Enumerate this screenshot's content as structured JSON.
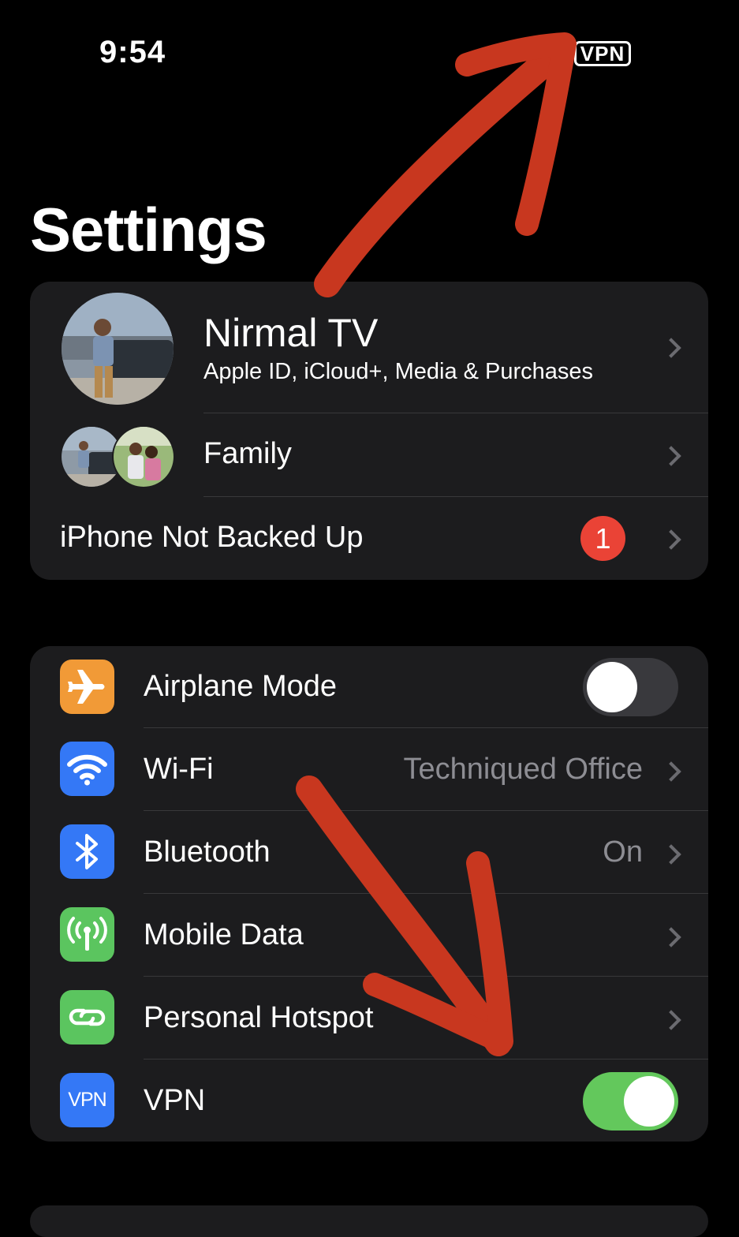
{
  "status_bar": {
    "time": "9:54",
    "vpn_indicator": "VPN"
  },
  "page": {
    "title": "Settings"
  },
  "account": {
    "name": "Nirmal TV",
    "subtitle": "Apple ID, iCloud+, Media & Purchases",
    "family_label": "Family",
    "backup_label": "iPhone Not Backed Up",
    "backup_badge": "1"
  },
  "connectivity": {
    "airplane": {
      "label": "Airplane Mode",
      "icon": "airplane-icon",
      "icon_color": "#f19a37",
      "on": false
    },
    "wifi": {
      "label": "Wi-Fi",
      "value": "Techniqued Office",
      "icon": "wifi-icon",
      "icon_color": "#3478f6"
    },
    "bluetooth": {
      "label": "Bluetooth",
      "value": "On",
      "icon": "bluetooth-icon",
      "icon_color": "#3478f6"
    },
    "mobile_data": {
      "label": "Mobile Data",
      "icon": "antenna-icon",
      "icon_color": "#5bc55f"
    },
    "hotspot": {
      "label": "Personal Hotspot",
      "icon": "hotspot-icon",
      "icon_color": "#5bc55f"
    },
    "vpn": {
      "label": "VPN",
      "icon_text": "VPN",
      "icon": "vpn-icon",
      "icon_color": "#3478f6",
      "on": true
    }
  },
  "colors": {
    "background": "#000000",
    "group": "#1c1c1e",
    "toggle_on": "#63c85c",
    "badge": "#ea4336",
    "annotation": "#d23a22"
  }
}
